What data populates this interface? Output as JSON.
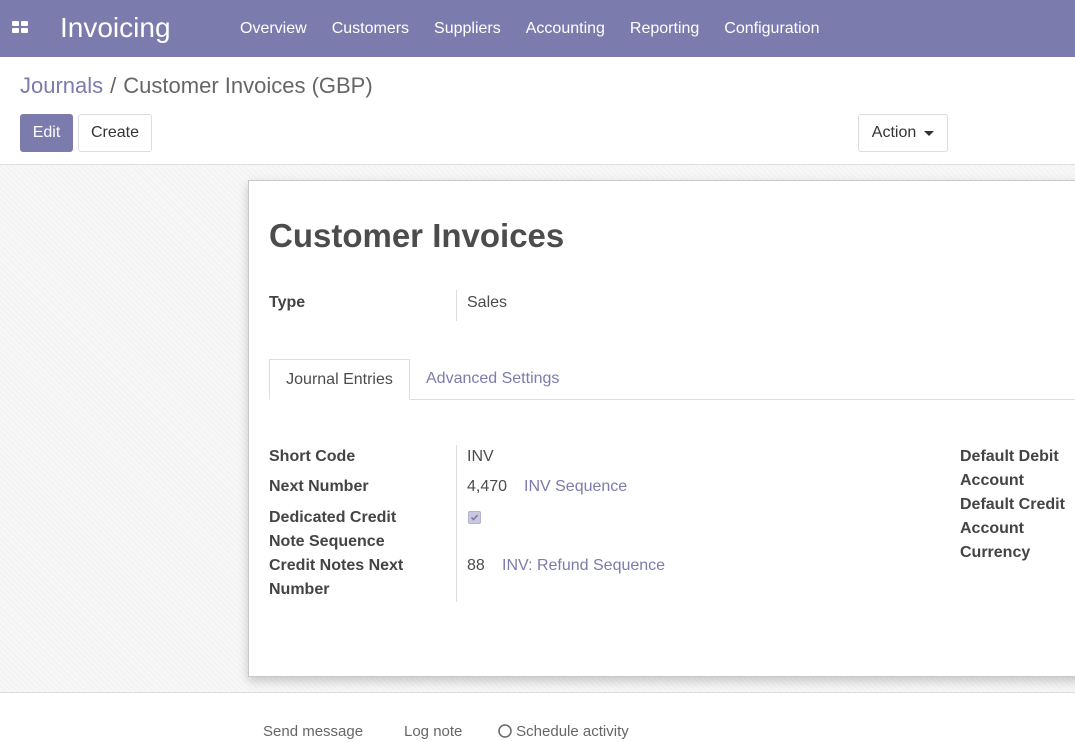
{
  "navbar": {
    "app_title": "Invoicing",
    "apps_icon": "grid-icon",
    "menu": [
      "Overview",
      "Customers",
      "Suppliers",
      "Accounting",
      "Reporting",
      "Configuration"
    ]
  },
  "breadcrumb": {
    "parent": "Journals",
    "separator": "/",
    "current": "Customer Invoices (GBP)"
  },
  "buttons": {
    "edit": "Edit",
    "create": "Create",
    "action": "Action"
  },
  "form": {
    "title": "Customer Invoices",
    "type_label": "Type",
    "type_value": "Sales",
    "tabs": [
      "Journal Entries",
      "Advanced Settings"
    ],
    "fields": {
      "short_code_label": "Short Code",
      "short_code_value": "INV",
      "next_number_label": "Next Number",
      "next_number_value": "4,470",
      "next_number_link": "INV Sequence",
      "dedicated_label_1": "Dedicated Credit",
      "dedicated_label_2": "Note Sequence",
      "dedicated_checked": true,
      "credit_next_label_1": "Credit Notes Next",
      "credit_next_label_2": "Number",
      "credit_next_value": "88",
      "credit_next_link": "INV: Refund Sequence"
    },
    "right_labels": [
      "Default Debit",
      "Account",
      "Default Credit",
      "Account",
      "Currency"
    ]
  },
  "chatter": {
    "send": "Send message",
    "log": "Log note",
    "schedule": "Schedule activity"
  },
  "colors": {
    "brand": "#7c7bad",
    "text": "#4c4c4c"
  }
}
